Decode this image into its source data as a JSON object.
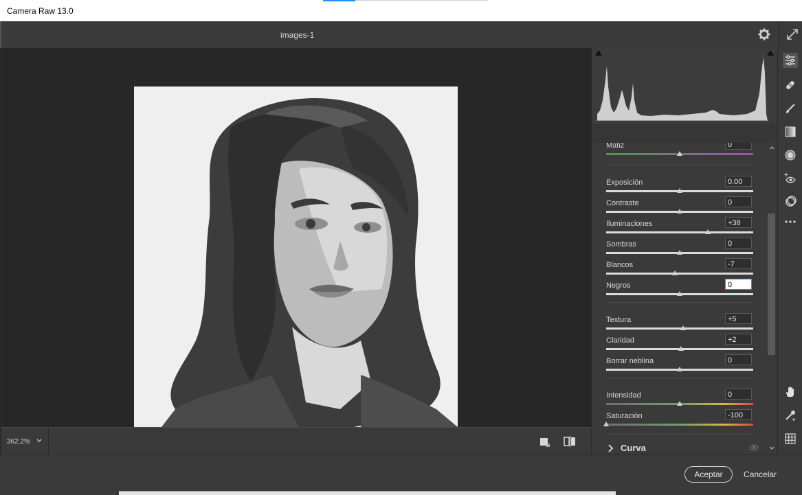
{
  "window": {
    "title": "Camera Raw 13.0"
  },
  "header": {
    "filename": "images-1"
  },
  "canvas": {
    "zoom": "362.2%"
  },
  "panel": {
    "partial_label": "Matiz",
    "partial_value": "0",
    "rows": [
      {
        "label": "Exposición",
        "value": "0.00",
        "position": 0.5
      },
      {
        "label": "Contraste",
        "value": "0",
        "position": 0.5
      },
      {
        "label": "Iluminaciones",
        "value": "+38",
        "position": 0.69
      },
      {
        "label": "Sombras",
        "value": "0",
        "position": 0.5
      },
      {
        "label": "Blancos",
        "value": "-7",
        "position": 0.465
      },
      {
        "label": "Negros",
        "value": "0",
        "position": 0.5
      },
      {
        "label": "Textura",
        "value": "+5",
        "position": 0.525
      },
      {
        "label": "Claridad",
        "value": "+2",
        "position": 0.51
      },
      {
        "label": "Borrar neblina",
        "value": "0",
        "position": 0.5
      },
      {
        "label": "Intensidad",
        "value": "0",
        "position": 0.5
      },
      {
        "label": "Saturación",
        "value": "-100",
        "position": 0.0
      }
    ],
    "section": "Curva"
  },
  "footer": {
    "ok_label": "Aceptar",
    "cancel_label": "Cancelar"
  },
  "tools": [
    "edit-sliders-icon",
    "healing-icon",
    "brush-icon",
    "gradient-icon",
    "radial-filter-icon",
    "red-eye-icon",
    "presets-icon",
    "more-icon",
    "hand-icon",
    "color-sampler-icon",
    "grid-icon"
  ]
}
